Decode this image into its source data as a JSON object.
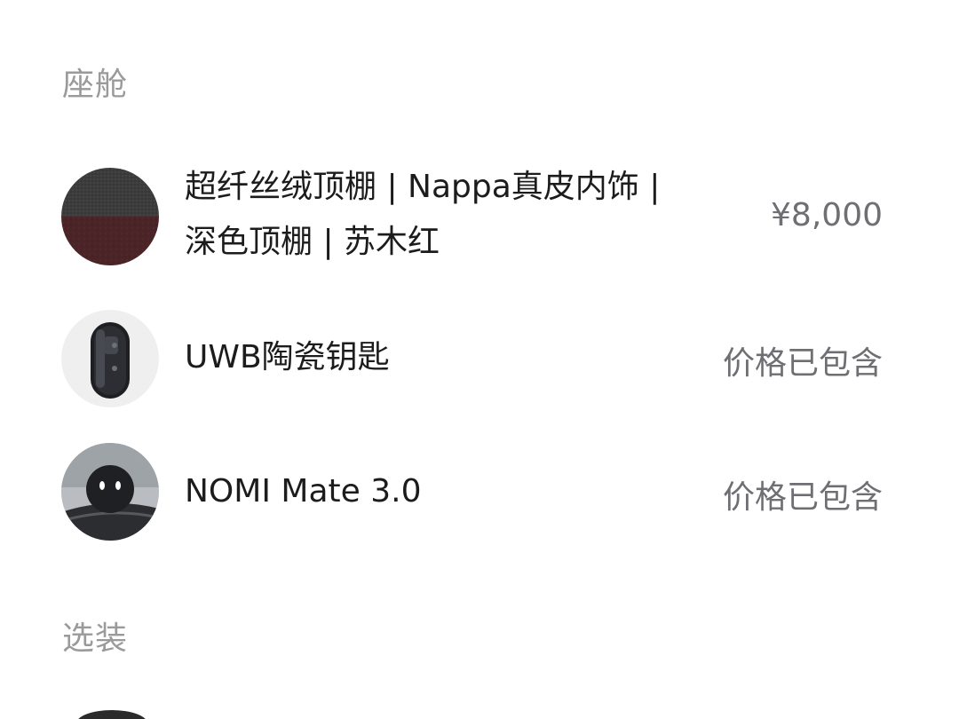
{
  "sections": {
    "cabin": {
      "title": "座舱",
      "items": [
        {
          "name_line1": "超纤丝绒顶棚 | Nappa真皮内饰 |",
          "name_line2": "深色顶棚 | 苏木红",
          "price": "¥8,000",
          "thumb_icon": "interior-swatch-icon"
        },
        {
          "name": "UWB陶瓷钥匙",
          "price": "价格已包含",
          "thumb_icon": "ceramic-key-icon"
        },
        {
          "name": "NOMI Mate 3.0",
          "price": "价格已包含",
          "thumb_icon": "nomi-robot-icon"
        }
      ]
    },
    "options": {
      "title": "选装"
    }
  },
  "colors": {
    "section_title": "#9a9a9a",
    "item_text": "#1c1c1c",
    "price_text": "#6e6e73",
    "swatch_top": "#3a3a3a",
    "swatch_bottom": "#4a2326"
  }
}
